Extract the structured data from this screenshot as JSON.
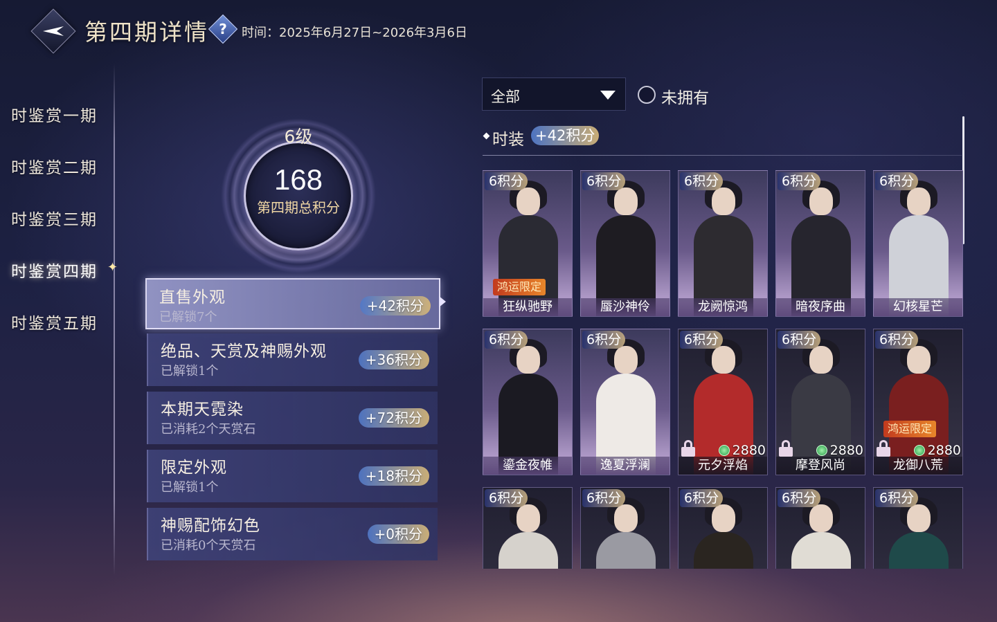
{
  "header": {
    "title": "第四期详情",
    "help_icon": "?",
    "time_text": "时间：2025年6月27日~2026年3月6日"
  },
  "nav": {
    "items": [
      {
        "label": "时鉴赏一期",
        "active": false
      },
      {
        "label": "时鉴赏二期",
        "active": false
      },
      {
        "label": "时鉴赏三期",
        "active": false
      },
      {
        "label": "时鉴赏四期",
        "active": true
      },
      {
        "label": "时鉴赏五期",
        "active": false
      }
    ]
  },
  "score": {
    "level": "6级",
    "total": "168",
    "label": "第四期总积分"
  },
  "categories": [
    {
      "title": "直售外观",
      "sub": "已解锁7个",
      "points": "+42积分",
      "active": true
    },
    {
      "title": "绝品、天赏及神赐外观",
      "sub": "已解锁1个",
      "points": "+36积分",
      "active": false
    },
    {
      "title": "本期天霓染",
      "sub": "已消耗2个天赏石",
      "points": "+72积分",
      "active": false
    },
    {
      "title": "限定外观",
      "sub": "已解锁1个",
      "points": "+18积分",
      "active": false
    },
    {
      "title": "神赐配饰幻色",
      "sub": "已消耗0个天赏石",
      "points": "+0积分",
      "active": false
    }
  ],
  "filter": {
    "select_value": "全部",
    "radio_label": "未拥有",
    "radio_checked": false
  },
  "section": {
    "title": "时装",
    "points": "+42积分"
  },
  "cards": [
    {
      "points": "6积分",
      "name": "狂纵驰野",
      "limited": "鸿运限定",
      "price": "",
      "locked": false,
      "dark": false,
      "outfit": "#2a2a33"
    },
    {
      "points": "6积分",
      "name": "蜃沙神伶",
      "limited": "",
      "price": "",
      "locked": false,
      "dark": false,
      "outfit": "#1e1c22"
    },
    {
      "points": "6积分",
      "name": "龙阙惊鸿",
      "limited": "",
      "price": "",
      "locked": false,
      "dark": false,
      "outfit": "#2d2b30"
    },
    {
      "points": "6积分",
      "name": "暗夜序曲",
      "limited": "",
      "price": "",
      "locked": false,
      "dark": false,
      "outfit": "#26252e"
    },
    {
      "points": "6积分",
      "name": "幻核星芒",
      "limited": "",
      "price": "",
      "locked": false,
      "dark": false,
      "outfit": "#cfd1d8"
    },
    {
      "points": "6积分",
      "name": "鎏金夜帷",
      "limited": "",
      "price": "",
      "locked": false,
      "dark": false,
      "outfit": "#1b1a22"
    },
    {
      "points": "6积分",
      "name": "逸夏浮澜",
      "limited": "",
      "price": "",
      "locked": false,
      "dark": false,
      "outfit": "#eeeae6"
    },
    {
      "points": "6积分",
      "name": "元夕浮焰",
      "limited": "",
      "price": "2880",
      "locked": true,
      "dark": true,
      "outfit": "#b32b2b"
    },
    {
      "points": "6积分",
      "name": "摩登风尚",
      "limited": "",
      "price": "2880",
      "locked": true,
      "dark": true,
      "outfit": "#3a3a44"
    },
    {
      "points": "6积分",
      "name": "龙御八荒",
      "limited": "鸿运限定",
      "price": "2880",
      "locked": true,
      "dark": true,
      "outfit": "#7a1f1f"
    },
    {
      "points": "6积分",
      "name": "",
      "limited": "",
      "price": "",
      "locked": false,
      "dark": true,
      "outfit": "#d6d2cc"
    },
    {
      "points": "6积分",
      "name": "",
      "limited": "",
      "price": "",
      "locked": false,
      "dark": true,
      "outfit": "#9a9aa2"
    },
    {
      "points": "6积分",
      "name": "",
      "limited": "",
      "price": "",
      "locked": false,
      "dark": true,
      "outfit": "#2a2520"
    },
    {
      "points": "6积分",
      "name": "",
      "limited": "",
      "price": "",
      "locked": false,
      "dark": true,
      "outfit": "#e0dcd4"
    },
    {
      "points": "6积分",
      "name": "",
      "limited": "",
      "price": "",
      "locked": false,
      "dark": true,
      "outfit": "#1f4a4a"
    }
  ],
  "icons": {
    "back": "back-arrow-icon",
    "help": "question-icon",
    "dropdown": "triangle-down-icon",
    "currency": "jade-coin-icon",
    "lock": "lock-icon"
  }
}
